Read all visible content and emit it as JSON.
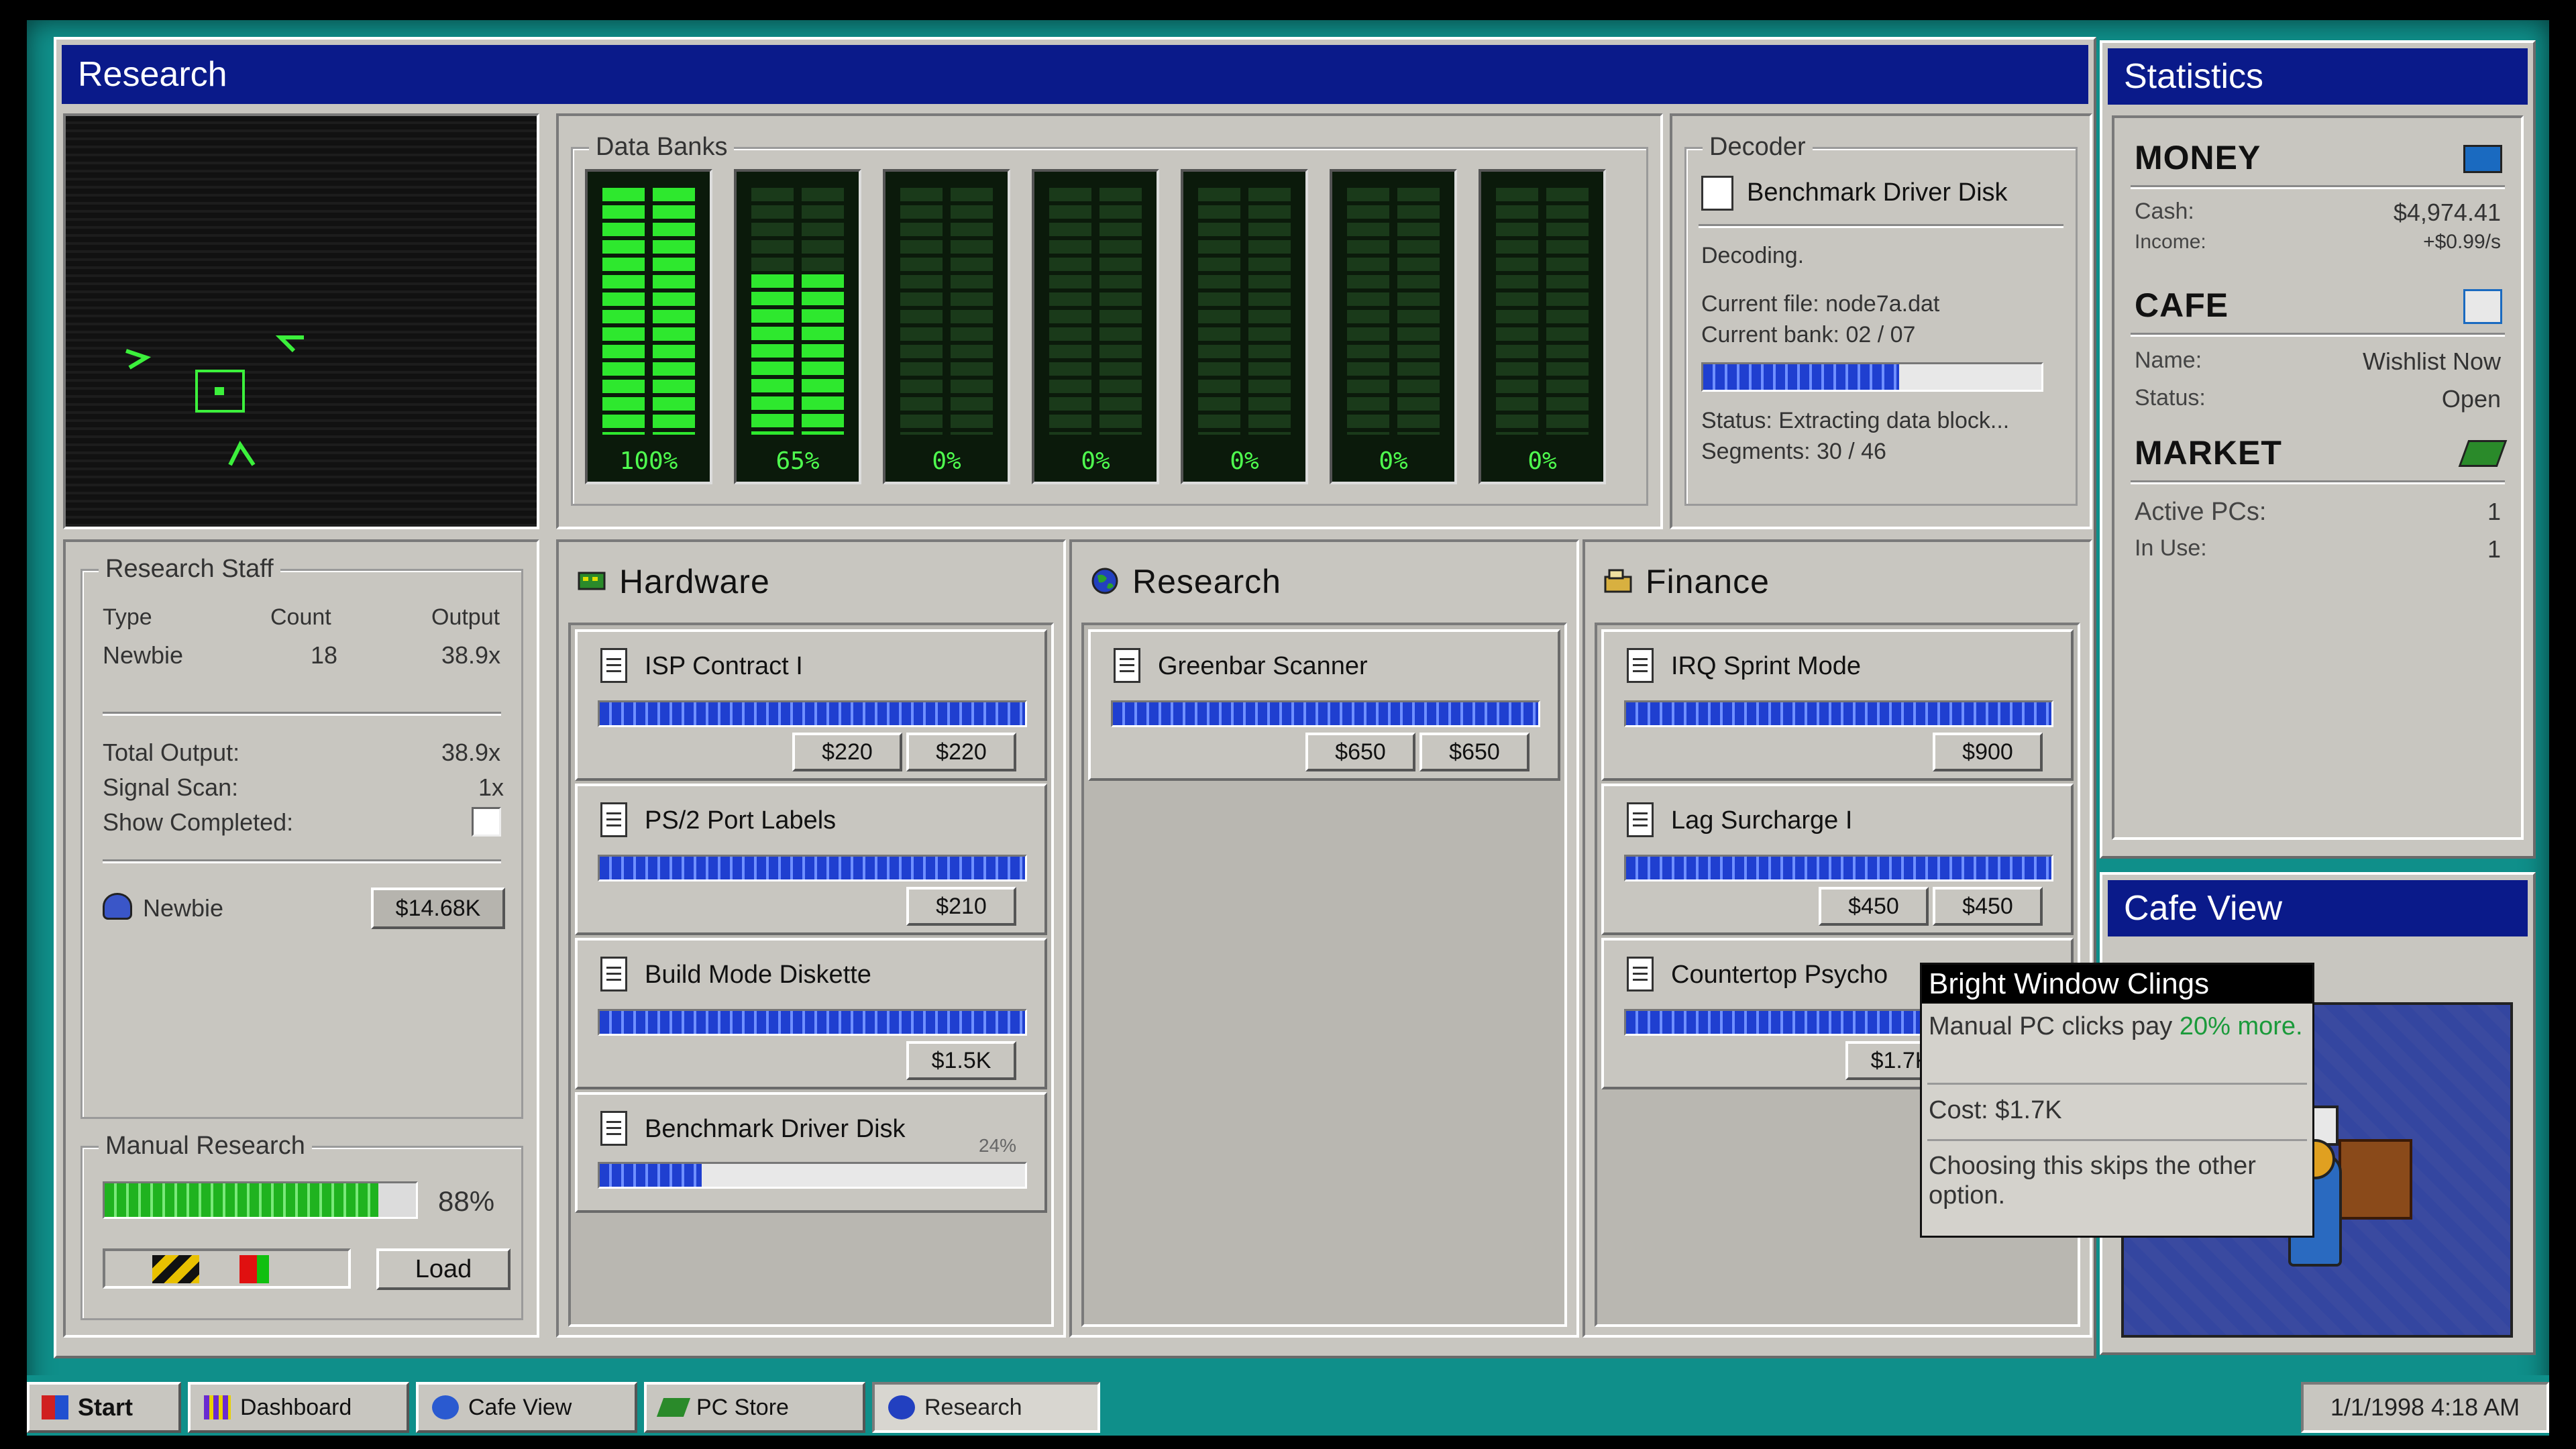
{
  "research_window": {
    "title": "Research",
    "data_banks": {
      "label": "Data Banks",
      "banks": [
        {
          "pct_label": "100%",
          "level": 1.0
        },
        {
          "pct_label": "65%",
          "level": 0.65
        },
        {
          "pct_label": "0%",
          "level": 0
        },
        {
          "pct_label": "0%",
          "level": 0
        },
        {
          "pct_label": "0%",
          "level": 0
        },
        {
          "pct_label": "0%",
          "level": 0
        },
        {
          "pct_label": "0%",
          "level": 0
        }
      ]
    },
    "decoder": {
      "label": "Decoder",
      "item": "Benchmark Driver Disk",
      "state": "Decoding.",
      "current_file": "Current file: node7a.dat",
      "current_bank": "Current bank: 02 / 07",
      "progress": 0.58,
      "status": "Status: Extracting data block...",
      "segments": "Segments: 30 / 46"
    },
    "staff": {
      "label": "Research Staff",
      "col_type": "Type",
      "col_count": "Count",
      "col_output": "Output",
      "row_type": "Newbie",
      "row_count": "18",
      "row_output": "38.9x",
      "total_output_label": "Total Output:",
      "total_output_value": "38.9x",
      "signal_scan_label": "Signal Scan:",
      "signal_scan_value": "1x",
      "show_completed_label": "Show Completed:",
      "hire_name": "Newbie",
      "hire_cost": "$14.68K"
    },
    "manual": {
      "label": "Manual Research",
      "progress": 0.88,
      "pct_label": "88%",
      "load_label": "Load"
    },
    "hardware": {
      "title": "Hardware",
      "items": [
        {
          "name": "ISP Contract I",
          "btn1": "$220",
          "btn2": "$220"
        },
        {
          "name": "PS/2 Port Labels",
          "btn1": "$210"
        },
        {
          "name": "Build Mode Diskette",
          "btn1": "$1.5K"
        },
        {
          "name": "Benchmark Driver Disk",
          "pct": "24%"
        }
      ]
    },
    "research": {
      "title": "Research",
      "items": [
        {
          "name": "Greenbar Scanner",
          "btn1": "$650",
          "btn2": "$650"
        }
      ]
    },
    "finance": {
      "title": "Finance",
      "items": [
        {
          "name": "IRQ Sprint Mode",
          "btn1": "$900"
        },
        {
          "name": "Lag Surcharge I",
          "btn1": "$450",
          "btn2": "$450"
        },
        {
          "name": "Countertop Psycho",
          "btn1": "$1.7K"
        }
      ]
    }
  },
  "tooltip": {
    "title": "Bright Window Clings",
    "desc_pre": "Manual PC clicks pay ",
    "desc_hl": "20%",
    "desc_post": "more.",
    "cost": "Cost: $1.7K",
    "note": "Choosing this skips the other option."
  },
  "statistics": {
    "title": "Statistics",
    "money": {
      "heading": "MONEY",
      "cash_label": "Cash:",
      "cash": "$4,974.41",
      "income_label": "Income:",
      "income": "+$0.99/s"
    },
    "cafe": {
      "heading": "CAFE",
      "name_label": "Name:",
      "name": "Wishlist Now",
      "status_label": "Status:",
      "status": "Open"
    },
    "market": {
      "heading": "MARKET",
      "active_label": "Active PCs:",
      "active": "1",
      "inuse_label": "In Use:",
      "inuse": "1"
    }
  },
  "cafe_view": {
    "title": "Cafe View"
  },
  "taskbar": {
    "start": "Start",
    "items": [
      "Dashboard",
      "Cafe View",
      "PC Store",
      "Research"
    ],
    "clock": "1/1/1998 4:18 AM"
  },
  "colors": {
    "titlebar": "#0a1a8a",
    "desktop": "#0f8f8a",
    "bank_green": "#2ee82e",
    "progress_blue": "#1f3fd0"
  }
}
